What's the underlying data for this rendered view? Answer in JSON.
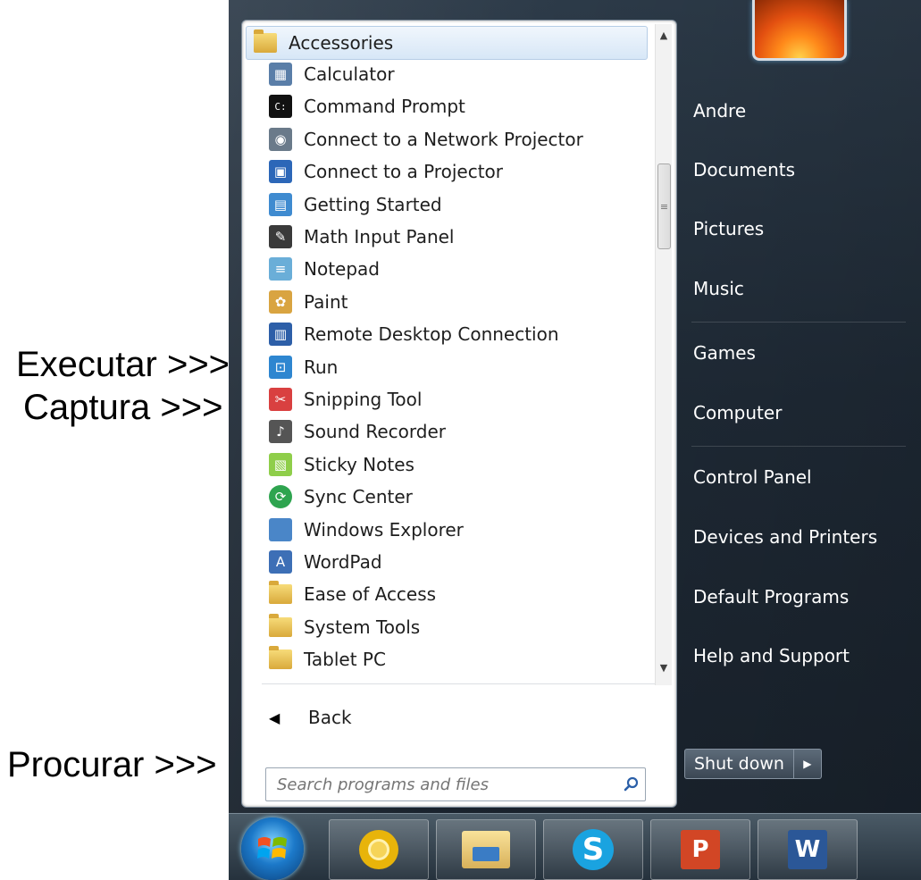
{
  "annotations": {
    "run": "Executar >>>",
    "snip": "Captura >>>",
    "search": "Procurar >>>"
  },
  "programs": {
    "header": "Accessories",
    "items": [
      {
        "label": "Calculator",
        "icon": "calculator-icon",
        "color": "#5a7ea8"
      },
      {
        "label": "Command Prompt",
        "icon": "command-prompt-icon",
        "color": "#111111"
      },
      {
        "label": "Connect to a Network Projector",
        "icon": "network-projector-icon",
        "color": "#6a7a8a"
      },
      {
        "label": "Connect to a Projector",
        "icon": "projector-icon",
        "color": "#2c67b8"
      },
      {
        "label": "Getting Started",
        "icon": "getting-started-icon",
        "color": "#3f8bd0"
      },
      {
        "label": "Math Input Panel",
        "icon": "math-input-icon",
        "color": "#3a3a3a"
      },
      {
        "label": "Notepad",
        "icon": "notepad-icon",
        "color": "#6aaed8"
      },
      {
        "label": "Paint",
        "icon": "paint-icon",
        "color": "#d9a441"
      },
      {
        "label": "Remote Desktop Connection",
        "icon": "remote-desktop-icon",
        "color": "#2d5fa8"
      },
      {
        "label": "Run",
        "icon": "run-icon",
        "color": "#2e86d0"
      },
      {
        "label": "Snipping Tool",
        "icon": "scissors-icon",
        "color": "#d94040"
      },
      {
        "label": "Sound Recorder",
        "icon": "microphone-icon",
        "color": "#555555"
      },
      {
        "label": "Sticky Notes",
        "icon": "sticky-notes-icon",
        "color": "#8fce4a"
      },
      {
        "label": "Sync Center",
        "icon": "sync-icon",
        "color": "#2ea44f"
      },
      {
        "label": "Windows Explorer",
        "icon": "folder-icon",
        "color": "#4a86c8"
      },
      {
        "label": "WordPad",
        "icon": "wordpad-icon",
        "color": "#3d6fb6"
      },
      {
        "label": "Ease of Access",
        "icon": "folder-icon",
        "color": "#e2b24a"
      },
      {
        "label": "System Tools",
        "icon": "folder-icon",
        "color": "#e2b24a"
      },
      {
        "label": "Tablet PC",
        "icon": "folder-icon",
        "color": "#e2b24a"
      }
    ]
  },
  "back_label": "Back",
  "search": {
    "placeholder": "Search programs and files"
  },
  "right_items": [
    "Andre",
    "Documents",
    "Pictures",
    "Music",
    "Games",
    "Computer",
    "Control Panel",
    "Devices and Printers",
    "Default Programs",
    "Help and Support"
  ],
  "shutdown_label": "Shut down",
  "taskbar": [
    "chrome-icon",
    "windows-explorer-icon",
    "skype-icon",
    "powerpoint-icon",
    "word-icon"
  ]
}
